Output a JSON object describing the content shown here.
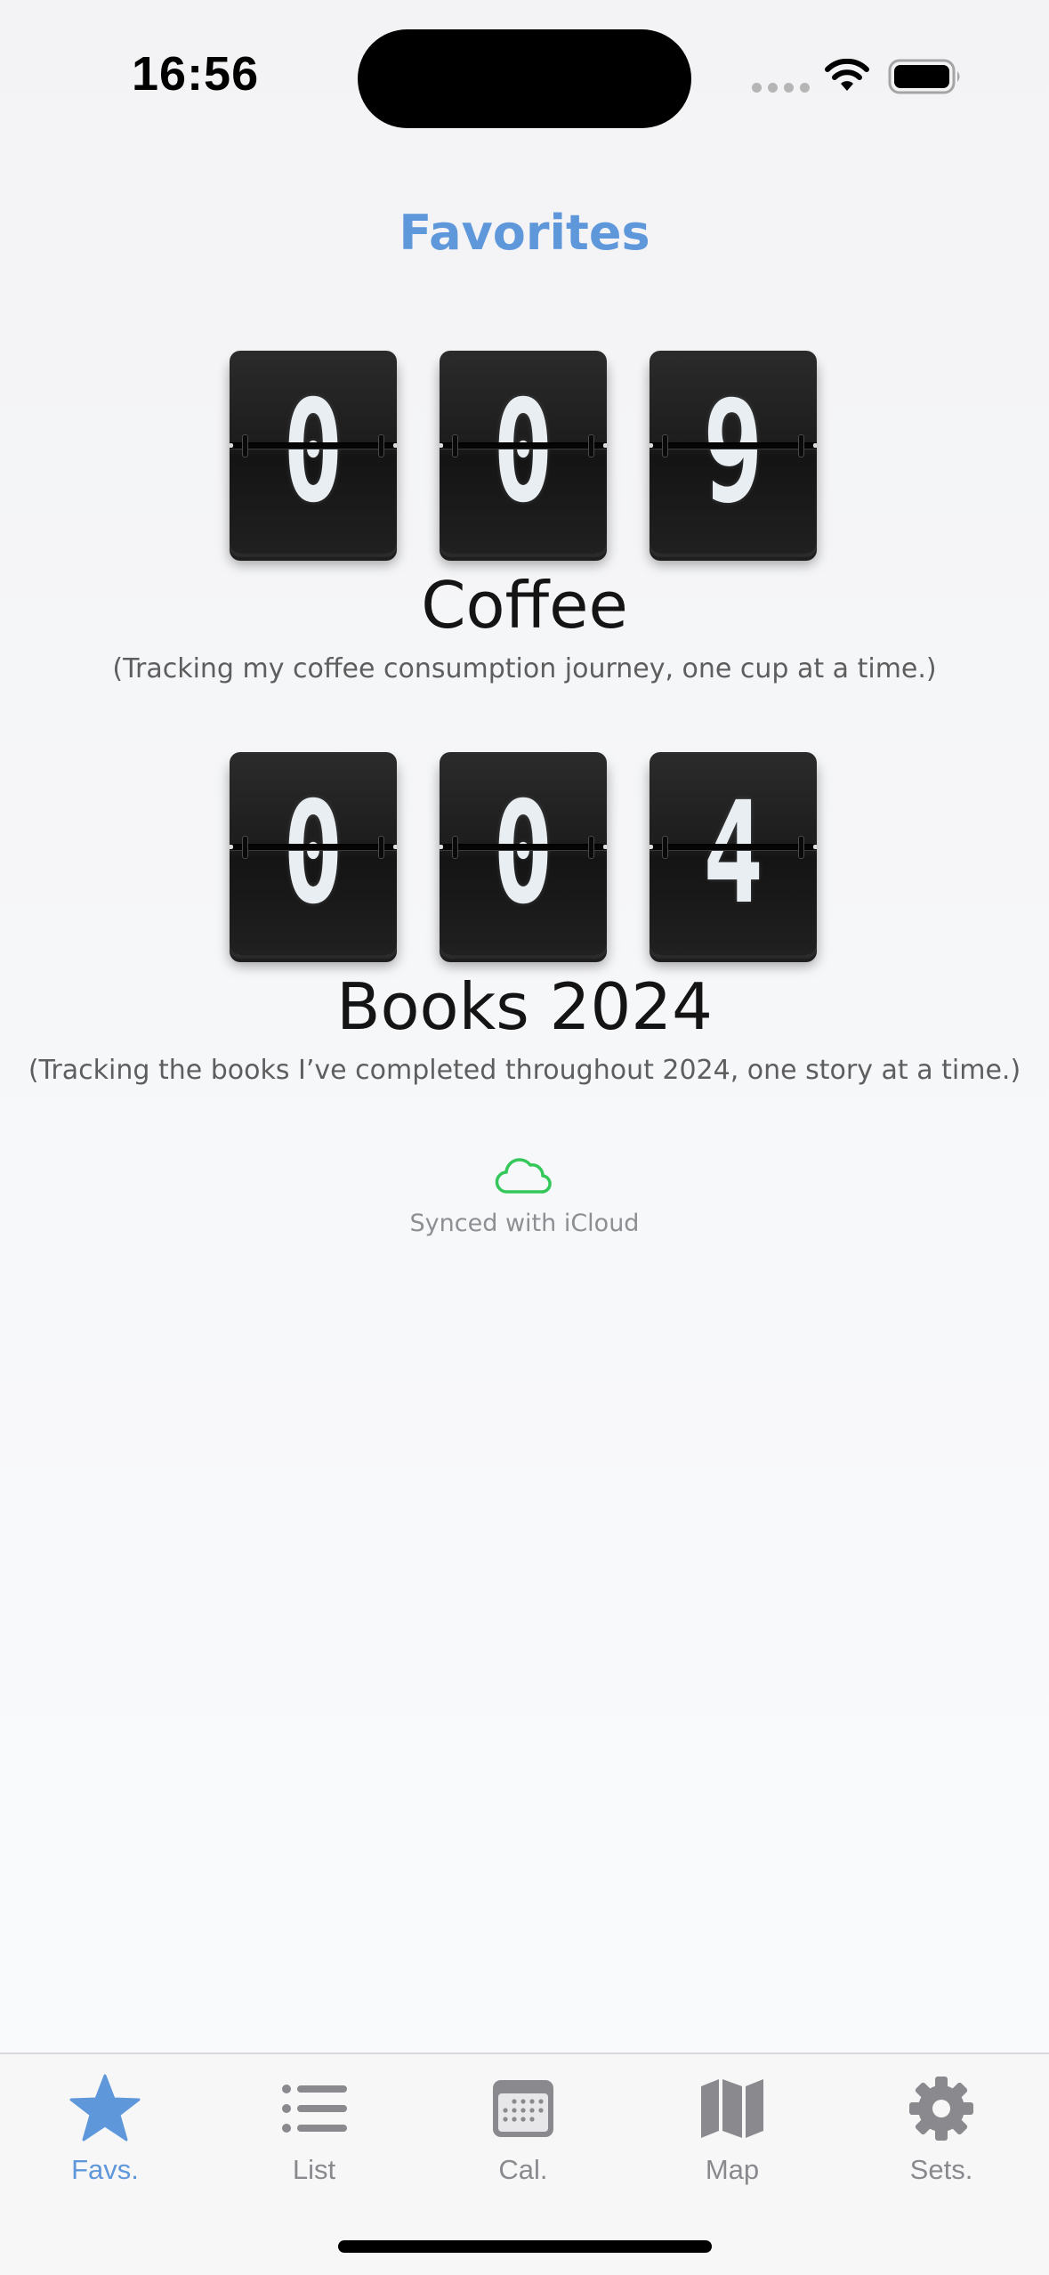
{
  "status_bar": {
    "time": "16:56"
  },
  "header": {
    "title": "Favorites"
  },
  "counters": [
    {
      "digits": [
        "0",
        "0",
        "9"
      ],
      "name": "Coffee",
      "description": "(Tracking my coffee consumption journey, one cup at a time.)"
    },
    {
      "digits": [
        "0",
        "0",
        "4"
      ],
      "name": "Books 2024",
      "description": "(Tracking the books I’ve completed throughout 2024, one story at a time.)"
    }
  ],
  "sync": {
    "status": "Synced with iCloud",
    "icon": "cloud-icon",
    "color": "#34c759"
  },
  "tabs": [
    {
      "label": "Favs.",
      "icon": "star-icon",
      "active": true
    },
    {
      "label": "List",
      "icon": "list-icon",
      "active": false
    },
    {
      "label": "Cal.",
      "icon": "calendar-icon",
      "active": false
    },
    {
      "label": "Map",
      "icon": "map-icon",
      "active": false
    },
    {
      "label": "Sets.",
      "icon": "gear-icon",
      "active": false
    }
  ],
  "colors": {
    "accent": "#5f97db",
    "inactive": "#8a8a8e",
    "tile": "#1c1c1c"
  }
}
